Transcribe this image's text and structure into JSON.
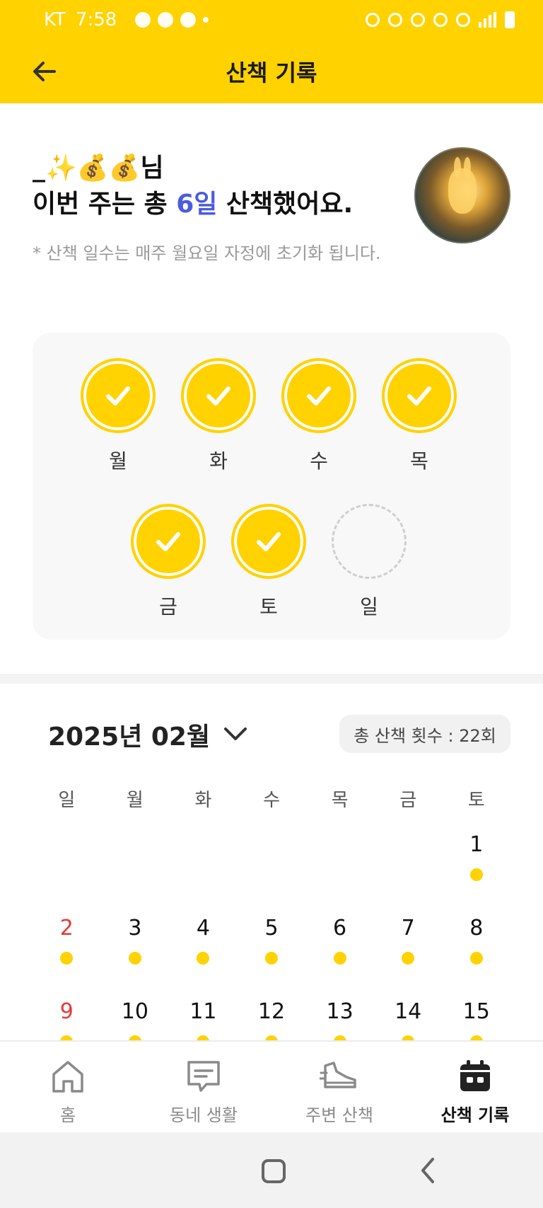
{
  "status_bar": {
    "carrier": "KT",
    "time": "7:58"
  },
  "header": {
    "title": "산책 기록",
    "back_icon": "arrow-left-icon"
  },
  "intro": {
    "username": "_✨💰💰님",
    "headline_prefix": "이번 주는 총 ",
    "days_count": "6일",
    "headline_suffix": " 산책했어요.",
    "note": "* 산책 일수는 매주 월요일 자정에 초기화 됩니다."
  },
  "week": {
    "days": [
      {
        "label": "월",
        "done": true
      },
      {
        "label": "화",
        "done": true
      },
      {
        "label": "수",
        "done": true
      },
      {
        "label": "목",
        "done": true
      },
      {
        "label": "금",
        "done": true
      },
      {
        "label": "토",
        "done": true
      },
      {
        "label": "일",
        "done": false
      }
    ]
  },
  "calendar": {
    "month_label": "2025년 02월",
    "total_label": "총 산책 횟수 : 22회",
    "weekdays": [
      "일",
      "월",
      "화",
      "수",
      "목",
      "금",
      "토"
    ],
    "rows": [
      [
        null,
        null,
        null,
        null,
        null,
        null,
        "1"
      ],
      [
        "2",
        "3",
        "4",
        "5",
        "6",
        "7",
        "8"
      ],
      [
        "9",
        "10",
        "11",
        "12",
        "13",
        "14",
        "15"
      ]
    ]
  },
  "bottom_nav": {
    "items": [
      {
        "label": "홈",
        "icon": "home-icon",
        "active": false
      },
      {
        "label": "동네 생활",
        "icon": "chat-icon",
        "active": false
      },
      {
        "label": "주변 산책",
        "icon": "shoe-icon",
        "active": false
      },
      {
        "label": "산책 기록",
        "icon": "calendar-icon",
        "active": true
      }
    ]
  },
  "colors": {
    "accent": "#FFD200",
    "highlight": "#4B5BE0",
    "sunday": "#E53935"
  }
}
